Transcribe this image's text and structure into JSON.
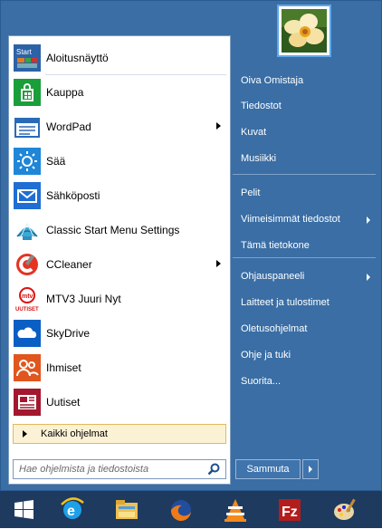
{
  "left_programs": [
    {
      "label": "Aloitusnäyttö",
      "icon": "start-screen-icon",
      "submenu": false
    },
    {
      "label": "Kauppa",
      "icon": "store-icon",
      "submenu": false
    },
    {
      "label": "WordPad",
      "icon": "wordpad-icon",
      "submenu": true
    },
    {
      "label": "Sää",
      "icon": "weather-icon",
      "submenu": false
    },
    {
      "label": "Sähköposti",
      "icon": "mail-icon",
      "submenu": false
    },
    {
      "label": "Classic Start Menu Settings",
      "icon": "classic-shell-icon",
      "submenu": false
    },
    {
      "label": "CCleaner",
      "icon": "ccleaner-icon",
      "submenu": true
    },
    {
      "label": "MTV3 Juuri Nyt",
      "icon": "mtv3-icon",
      "submenu": false
    },
    {
      "label": "SkyDrive",
      "icon": "skydrive-icon",
      "submenu": false
    },
    {
      "label": "Ihmiset",
      "icon": "people-icon",
      "submenu": false
    },
    {
      "label": "Uutiset",
      "icon": "news-icon",
      "submenu": false
    }
  ],
  "start_tile_text": "Start",
  "mtv3_icon_text": "UUTISET",
  "all_programs_label": "Kaikki ohjelmat",
  "search_placeholder": "Hae ohjelmista ja tiedostoista",
  "right_items": [
    {
      "label": "Oiva Omistaja",
      "submenu": false
    },
    {
      "label": "Tiedostot",
      "submenu": false
    },
    {
      "label": "Kuvat",
      "submenu": false
    },
    {
      "label": "Musiikki",
      "submenu": false
    },
    {
      "label": "Pelit",
      "submenu": false
    },
    {
      "label": "Viimeisimmät tiedostot",
      "submenu": true
    },
    {
      "label": "Tämä tietokone",
      "submenu": false
    },
    {
      "label": "Ohjauspaneeli",
      "submenu": true
    },
    {
      "label": "Laitteet ja tulostimet",
      "submenu": false
    },
    {
      "label": "Oletusohjelmat",
      "submenu": false
    },
    {
      "label": "Ohje ja tuki",
      "submenu": false
    },
    {
      "label": "Suorita...",
      "submenu": false
    }
  ],
  "shutdown_label": "Sammuta",
  "taskbar_items": [
    "start-button-icon",
    "internet-explorer-icon",
    "file-explorer-icon",
    "firefox-icon",
    "vlc-icon",
    "filezilla-icon",
    "paint-icon"
  ],
  "colors": {
    "menu_bg": "#3a6ea5",
    "taskbar_bg": "#1e3a5e",
    "highlight": "#fbf2d5"
  }
}
